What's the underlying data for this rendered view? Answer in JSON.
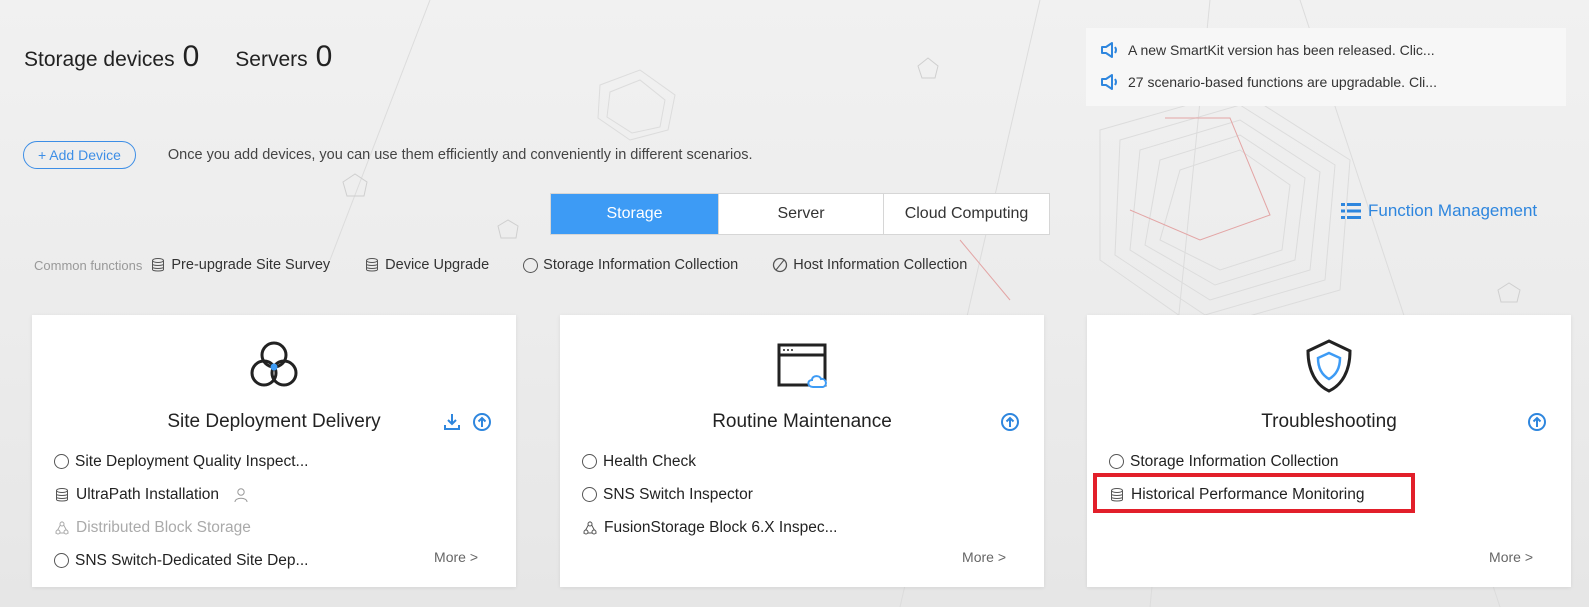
{
  "counts": {
    "storage_label": "Storage devices",
    "storage_value": "0",
    "servers_label": "Servers",
    "servers_value": "0"
  },
  "notices": [
    {
      "icon": "speaker-icon",
      "text": "A new SmartKit version has been released. Clic..."
    },
    {
      "icon": "speaker-icon",
      "text": "27 scenario-based functions are upgradable. Cli..."
    }
  ],
  "add_device": {
    "button_label": "+ Add Device",
    "hint": "Once you add devices, you can use them efficiently and conveniently in different scenarios."
  },
  "tabs": [
    {
      "label": "Storage",
      "active": true
    },
    {
      "label": "Server",
      "active": false
    },
    {
      "label": "Cloud Computing",
      "active": false
    }
  ],
  "function_management": {
    "label": "Function Management",
    "icon": "list-icon"
  },
  "common_functions": {
    "label": "Common functions",
    "items": [
      {
        "label": "Pre-upgrade Site Survey",
        "icon": "database-icon"
      },
      {
        "label": "Device Upgrade",
        "icon": "database-icon"
      },
      {
        "label": "Storage Information Collection",
        "icon": "circle-icon"
      },
      {
        "label": "Host Information Collection",
        "icon": "circle-slash-icon"
      }
    ]
  },
  "cards": [
    {
      "title": "Site Deployment Delivery",
      "icon": "hexagon-cluster-icon",
      "actions": [
        "download-icon",
        "upgrade-icon"
      ],
      "items": [
        {
          "label": "Site Deployment Quality Inspect...",
          "icon": "circle-icon"
        },
        {
          "label": "UltraPath Installation",
          "icon": "database-icon",
          "extra": "user-icon"
        },
        {
          "label": "Distributed Block Storage",
          "icon": "cluster-icon",
          "disabled": true
        },
        {
          "label": "SNS Switch-Dedicated Site Dep...",
          "icon": "circle-icon"
        }
      ],
      "more": "More >"
    },
    {
      "title": "Routine Maintenance",
      "icon": "window-cloud-icon",
      "actions": [
        "upgrade-icon"
      ],
      "items": [
        {
          "label": "Health Check",
          "icon": "circle-icon"
        },
        {
          "label": "SNS Switch Inspector",
          "icon": "circle-icon"
        },
        {
          "label": "FusionStorage Block 6.X Inspec...",
          "icon": "cluster-icon"
        }
      ],
      "more": "More >"
    },
    {
      "title": "Troubleshooting",
      "icon": "shield-icon",
      "actions": [
        "upgrade-icon"
      ],
      "items": [
        {
          "label": "Storage Information Collection",
          "icon": "circle-icon"
        },
        {
          "label": "Historical Performance Monitoring",
          "icon": "database-icon"
        }
      ],
      "more": "More >"
    }
  ],
  "colors": {
    "accent": "#3d9bf5",
    "link": "#2e86de",
    "highlight": "#e21f2a"
  }
}
